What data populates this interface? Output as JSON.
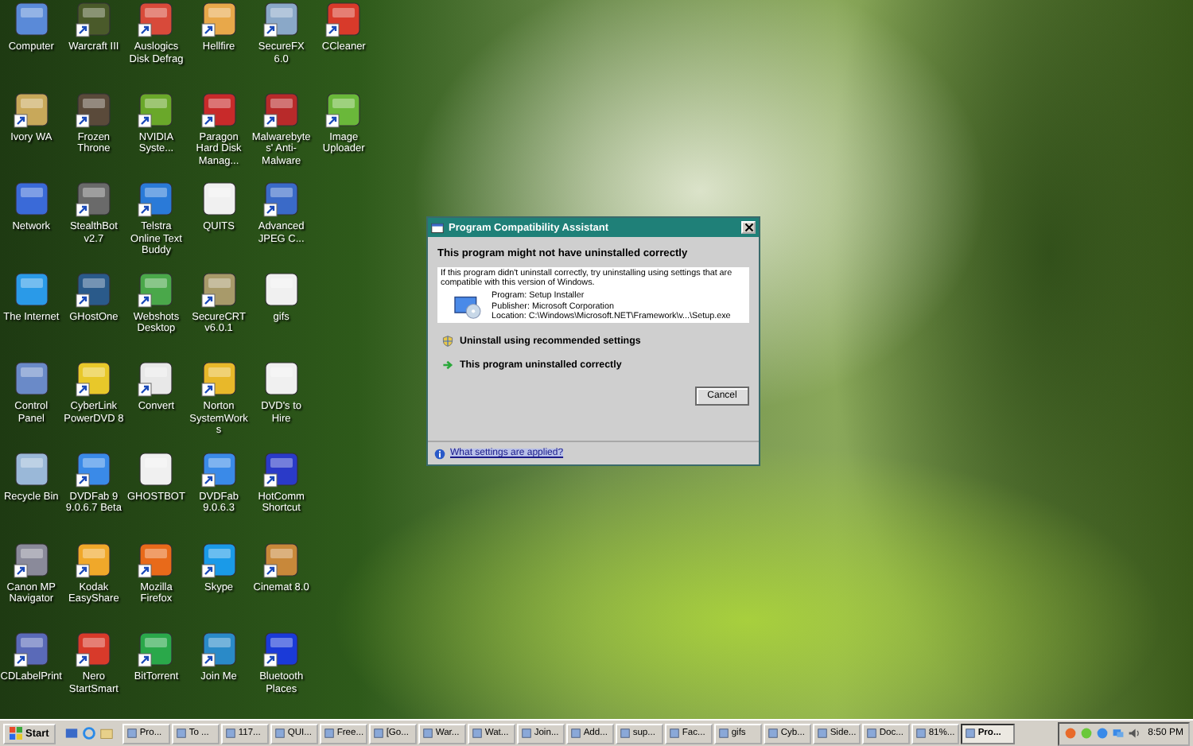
{
  "desktop": {
    "rows": [
      [
        {
          "label": "Computer",
          "shortcut": false,
          "color": "#5a8ad8"
        },
        {
          "label": "Warcraft III",
          "shortcut": true,
          "color": "#4a5a2a"
        },
        {
          "label": "Auslogics Disk Defrag",
          "shortcut": true,
          "color": "#d84a3a"
        },
        {
          "label": "Hellfire",
          "shortcut": true,
          "color": "#e8a84a"
        },
        {
          "label": "SecureFX 6.0",
          "shortcut": true,
          "color": "#8aa8c8"
        },
        {
          "label": "CCleaner",
          "shortcut": true,
          "color": "#d83a2a"
        }
      ],
      [
        {
          "label": "Ivory WA",
          "shortcut": true,
          "color": "#c8a85a"
        },
        {
          "label": "Frozen Throne",
          "shortcut": true,
          "color": "#5a4a3a"
        },
        {
          "label": "NVIDIA Syste...",
          "shortcut": true,
          "color": "#6aa82a"
        },
        {
          "label": "Paragon Hard Disk Manag...",
          "shortcut": true,
          "color": "#c82a2a"
        },
        {
          "label": "Malwarebytes' Anti-Malware",
          "shortcut": true,
          "color": "#b82a2a"
        },
        {
          "label": "Image Uploader",
          "shortcut": true,
          "color": "#6ab83a"
        }
      ],
      [
        {
          "label": "Network",
          "shortcut": false,
          "color": "#3a6ad8"
        },
        {
          "label": "StealthBot v2.7",
          "shortcut": true,
          "color": "#6a6a6a"
        },
        {
          "label": "Telstra Online Text Buddy",
          "shortcut": true,
          "color": "#2a7ad8"
        },
        {
          "label": "QUITS",
          "shortcut": false,
          "color": "#f0f0f0"
        },
        {
          "label": "Advanced JPEG C...",
          "shortcut": true,
          "color": "#3a6ac8"
        }
      ],
      [
        {
          "label": "The Internet",
          "shortcut": false,
          "color": "#2a9ae8"
        },
        {
          "label": "GHostOne",
          "shortcut": true,
          "color": "#2a5a8a"
        },
        {
          "label": "Webshots Desktop",
          "shortcut": true,
          "color": "#4aa84a"
        },
        {
          "label": "SecureCRT v6.0.1",
          "shortcut": true,
          "color": "#a89a6a"
        },
        {
          "label": "gifs",
          "shortcut": false,
          "color": "#f0f0f0"
        }
      ],
      [
        {
          "label": "Control Panel",
          "shortcut": false,
          "color": "#6a8ac8"
        },
        {
          "label": "CyberLink PowerDVD 8",
          "shortcut": true,
          "color": "#e8c82a"
        },
        {
          "label": "Convert",
          "shortcut": true,
          "color": "#e8e8e8"
        },
        {
          "label": "Norton SystemWorks",
          "shortcut": true,
          "color": "#e8b82a"
        },
        {
          "label": "DVD's to Hire",
          "shortcut": false,
          "color": "#f0f0f0"
        }
      ],
      [
        {
          "label": "Recycle Bin",
          "shortcut": false,
          "color": "#9ab8d8"
        },
        {
          "label": "DVDFab 9 9.0.6.7 Beta",
          "shortcut": true,
          "color": "#3a8ae8"
        },
        {
          "label": "GHOSTBOT",
          "shortcut": false,
          "color": "#f0f0f0"
        },
        {
          "label": "DVDFab 9.0.6.3",
          "shortcut": true,
          "color": "#3a8ae8"
        },
        {
          "label": "HotComm Shortcut",
          "shortcut": true,
          "color": "#2a3ac8"
        }
      ],
      [
        {
          "label": "Canon MP Navigator",
          "shortcut": true,
          "color": "#8a8a9a"
        },
        {
          "label": "Kodak EasyShare",
          "shortcut": true,
          "color": "#f0a82a"
        },
        {
          "label": "Mozilla Firefox",
          "shortcut": true,
          "color": "#e86a1a"
        },
        {
          "label": "Skype",
          "shortcut": true,
          "color": "#1a9ae8"
        },
        {
          "label": "Cinemat 8.0",
          "shortcut": true,
          "color": "#c8883a"
        }
      ],
      [
        {
          "label": "CDLabelPrint",
          "shortcut": true,
          "color": "#5a6ab8"
        },
        {
          "label": "Nero StartSmart",
          "shortcut": true,
          "color": "#d83a2a"
        },
        {
          "label": "BitTorrent",
          "shortcut": true,
          "color": "#2aa84a"
        },
        {
          "label": "Join Me",
          "shortcut": true,
          "color": "#2a8ac8"
        },
        {
          "label": "Bluetooth Places",
          "shortcut": true,
          "color": "#1a3ad8"
        }
      ]
    ]
  },
  "dialog": {
    "title": "Program Compatibility Assistant",
    "heading": "This program might not have uninstalled correctly",
    "description": "If this program didn't uninstall correctly, try uninstalling using settings that are compatible with this version of Windows.",
    "details": [
      "Program: Setup Installer",
      "Publisher: Microsoft Corporation",
      "Location: C:\\Windows\\Microsoft.NET\\Framework\\v...\\Setup.exe"
    ],
    "options": [
      {
        "kind": "shield",
        "label": "Uninstall using recommended settings"
      },
      {
        "kind": "arrow",
        "label": "This program uninstalled correctly"
      }
    ],
    "cancel": "Cancel",
    "help_link": "What settings are applied?"
  },
  "taskbar": {
    "start": "Start",
    "tasks": [
      {
        "label": "Pro...",
        "selected": false
      },
      {
        "label": "To ...",
        "selected": false
      },
      {
        "label": "117...",
        "selected": false
      },
      {
        "label": "QUI...",
        "selected": false
      },
      {
        "label": "Free...",
        "selected": false
      },
      {
        "label": "[Go...",
        "selected": false
      },
      {
        "label": "War...",
        "selected": false
      },
      {
        "label": "Wat...",
        "selected": false
      },
      {
        "label": "Join...",
        "selected": false
      },
      {
        "label": "Add...",
        "selected": false
      },
      {
        "label": "sup...",
        "selected": false
      },
      {
        "label": "Fac...",
        "selected": false
      },
      {
        "label": "gifs",
        "selected": false
      },
      {
        "label": "Cyb...",
        "selected": false
      },
      {
        "label": "Side...",
        "selected": false
      },
      {
        "label": "Doc...",
        "selected": false
      },
      {
        "label": "81%...",
        "selected": false
      },
      {
        "label": "Pro...",
        "selected": true
      }
    ],
    "clock": "8:50 PM"
  }
}
